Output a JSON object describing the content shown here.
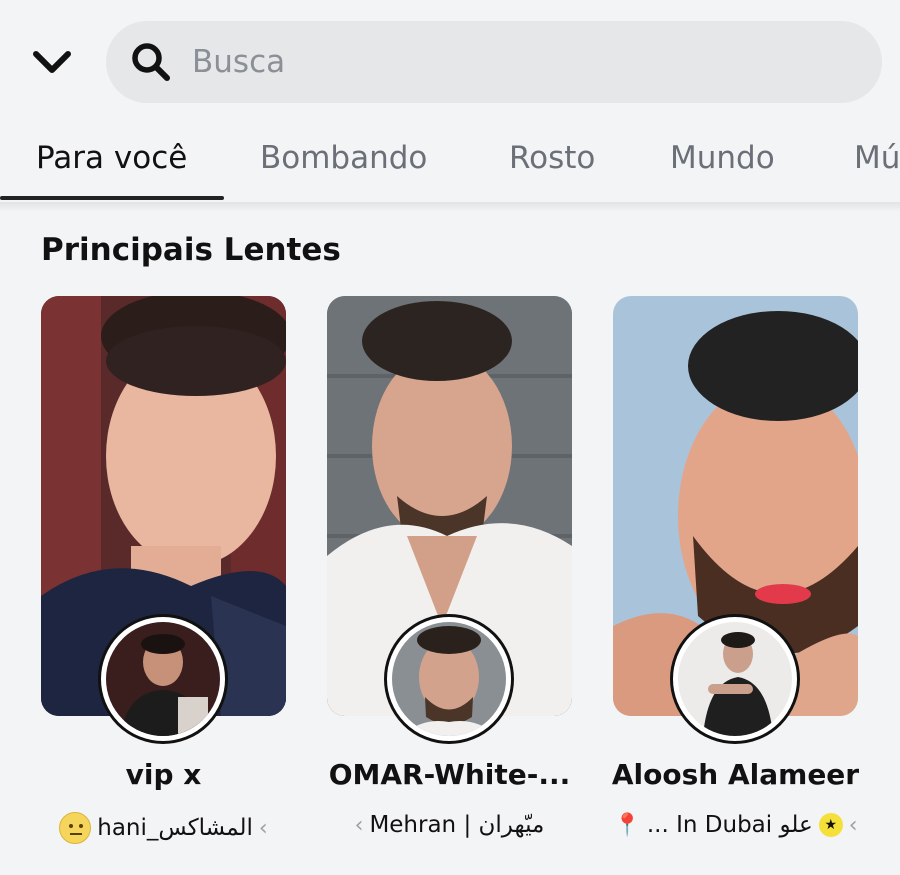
{
  "search": {
    "placeholder": "Busca"
  },
  "tabs": [
    {
      "label": "Para você",
      "active": true
    },
    {
      "label": "Bombando"
    },
    {
      "label": "Rosto"
    },
    {
      "label": "Mundo"
    },
    {
      "label": "Mú"
    }
  ],
  "section": {
    "title": "Principais Lentes"
  },
  "cards": [
    {
      "name": "vip x",
      "creator": "hani_المشاكس",
      "creator_icon": "neutral-face-emoji",
      "chevron": "‹"
    },
    {
      "name": "OMAR-White-...",
      "creator": "Mehran | ميّهران",
      "chevron": "‹"
    },
    {
      "name": "Aloosh Alameer",
      "creator": "... In Dubai علو",
      "creator_icon": "star-badge",
      "pin_icon": "round-pushpin",
      "chevron": "‹"
    }
  ],
  "colors": {
    "background": "#f3f4f6",
    "search_bg": "#e6e7e9",
    "accent": "#111111"
  }
}
